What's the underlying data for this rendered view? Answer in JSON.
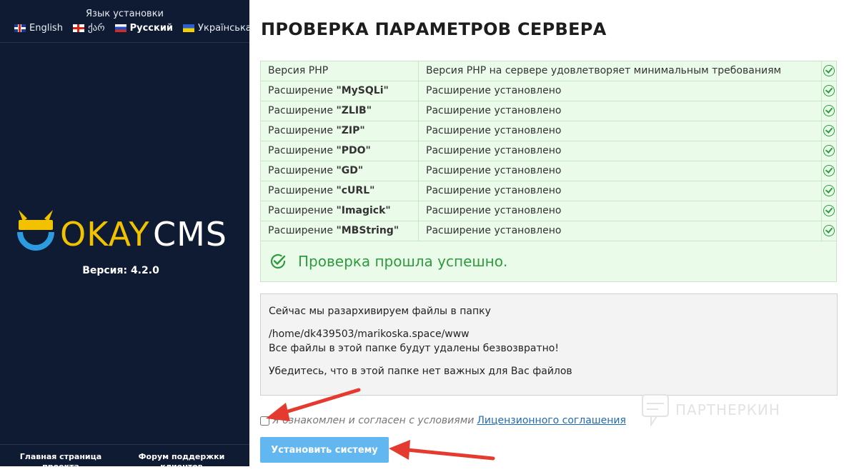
{
  "sidebar": {
    "lang_title": "Язык установки",
    "languages": [
      {
        "label": "English",
        "flag": "uk-flag-icon",
        "active": false
      },
      {
        "label": "ქარ",
        "flag": "georgia-flag-icon",
        "active": false
      },
      {
        "label": "Русский",
        "flag": "russia-flag-icon",
        "active": true
      },
      {
        "label": "Українська",
        "flag": "ukraine-flag-icon",
        "active": false
      }
    ],
    "logo_text": {
      "okay": "OKAY",
      "cms": "CMS"
    },
    "version": "Версия: 4.2.0",
    "footer_links": [
      "Главная страница проекта",
      "Форум поддержки клиентов"
    ]
  },
  "main": {
    "title": "ПРОВЕРКА ПАРАМЕТРОВ СЕРВЕРА",
    "checks": [
      {
        "prefix": "Версия PHP",
        "name": "",
        "status": "Версия PHP на сервере удовлетворяет минимальным требованиям"
      },
      {
        "prefix": "Расширение ",
        "name": "\"MySQLi\"",
        "status": "Расширение установлено"
      },
      {
        "prefix": "Расширение ",
        "name": "\"ZLIB\"",
        "status": "Расширение установлено"
      },
      {
        "prefix": "Расширение ",
        "name": "\"ZIP\"",
        "status": "Расширение установлено"
      },
      {
        "prefix": "Расширение ",
        "name": "\"PDO\"",
        "status": "Расширение установлено"
      },
      {
        "prefix": "Расширение ",
        "name": "\"GD\"",
        "status": "Расширение установлено"
      },
      {
        "prefix": "Расширение ",
        "name": "\"cURL\"",
        "status": "Расширение установлено"
      },
      {
        "prefix": "Расширение ",
        "name": "\"Imagick\"",
        "status": "Расширение установлено"
      },
      {
        "prefix": "Расширение ",
        "name": "\"MBString\"",
        "status": "Расширение установлено"
      }
    ],
    "success_text": "Проверка прошла успешно.",
    "info": {
      "line1": "Сейчас мы разархивируем файлы в папку",
      "path": "/home/dk439503/marikoska.space/www",
      "warning": "Все файлы в этой папке будут удалены безвозвратно!",
      "line4": "Убедитесь, что в этой папке нет важных для Вас файлов"
    },
    "agree_text": "Я ознакомлен и согласен с условиями",
    "license_link": "Лицензионного соглашения",
    "install_button": "Установить систему"
  },
  "watermark": "ПАРТНЕРКИН",
  "colors": {
    "sidebar_bg": "#0e1b33",
    "logo_yellow": "#f2c200",
    "logo_blue": "#2c9be0",
    "success_green": "#2d9b3e",
    "button_blue": "#63b7f0",
    "arrow_red": "#e53a2f"
  }
}
